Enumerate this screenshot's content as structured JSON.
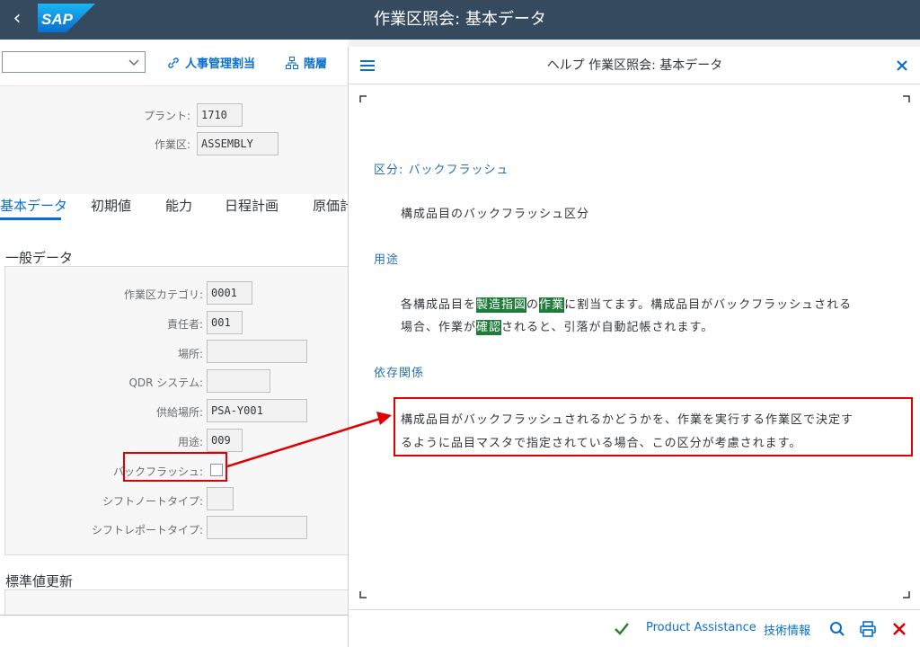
{
  "shell": {
    "title": "作業区照会: 基本データ",
    "logo_text": "SAP"
  },
  "toolbar": {
    "combo_value": "",
    "hr_assignment": "人事管理割当",
    "hierarchy": "階層"
  },
  "header": {
    "plant_label": "プラント:",
    "plant_value": "1710",
    "workcenter_label": "作業区:",
    "workcenter_value": "ASSEMBLY"
  },
  "tabs": [
    "基本データ",
    "初期値",
    "能力",
    "日程計画",
    "原価計"
  ],
  "general": {
    "title": "一般データ",
    "fields": [
      {
        "label": "作業区カテゴリ:",
        "value": "0001"
      },
      {
        "label": "責任者:",
        "value": "001"
      },
      {
        "label": "場所:",
        "value": ""
      },
      {
        "label": "QDR システム:",
        "value": ""
      },
      {
        "label": "供給場所:",
        "value": "PSA-Y001"
      },
      {
        "label": "用途:",
        "value": "009"
      },
      {
        "label": "バックフラッシュ:",
        "value": ""
      },
      {
        "label": "シフトノートタイプ:",
        "value": ""
      },
      {
        "label": "シフトレポートタイプ:",
        "value": ""
      }
    ]
  },
  "standard": {
    "title": "標準値更新"
  },
  "dialog": {
    "title": "ヘルプ 作業区照会: 基本データ",
    "heading1": "区分: バックフラッシュ",
    "line1": "構成品目のバックフラッシュ区分",
    "heading2": "用途",
    "usage_a": "各構成品目を",
    "usage_hl1": "製造指図",
    "usage_b": "の",
    "usage_hl2": "作業",
    "usage_c": "に割当てます。構成品目がバックフラッシュされる",
    "usage_d": "場合、作業が",
    "usage_hl3": "確認",
    "usage_e": "されると、引落が自動記帳されます。",
    "heading3": "依存関係",
    "dep_line1": "構成品目がバックフラッシュされるかどうかを、作業を実行する作業区で決定す",
    "dep_line2": "るように品目マスタで指定されている場合、この区分が考慮されます。",
    "footer": {
      "product_assistance": "Product Assistance",
      "tech_info": "技術情報"
    }
  },
  "colors": {
    "shell": "#354a5f",
    "accent": "#0a6ed1",
    "highlight": "#1e7b3a",
    "annotation": "#e00000"
  }
}
